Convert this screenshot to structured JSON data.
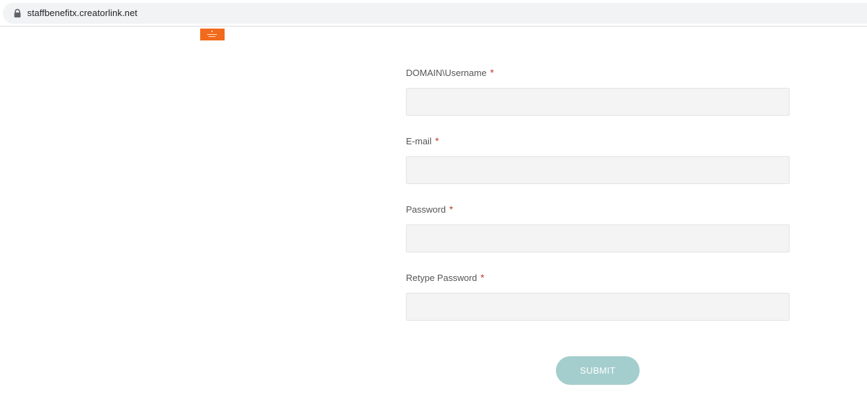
{
  "browser": {
    "url": "staffbenefitx.creatorlink.net",
    "lock_icon": "lock-icon"
  },
  "logo": {
    "color": "#f26a1b"
  },
  "form": {
    "required_marker": "*",
    "fields": [
      {
        "label": "DOMAIN\\Username",
        "value": "",
        "placeholder": ""
      },
      {
        "label": "E-mail",
        "value": "",
        "placeholder": ""
      },
      {
        "label": "Password",
        "value": "",
        "placeholder": ""
      },
      {
        "label": "Retype Password",
        "value": "",
        "placeholder": ""
      }
    ],
    "submit_label": "SUBMIT",
    "submit_color": "#a4cecd",
    "required_color": "#c0392b"
  }
}
